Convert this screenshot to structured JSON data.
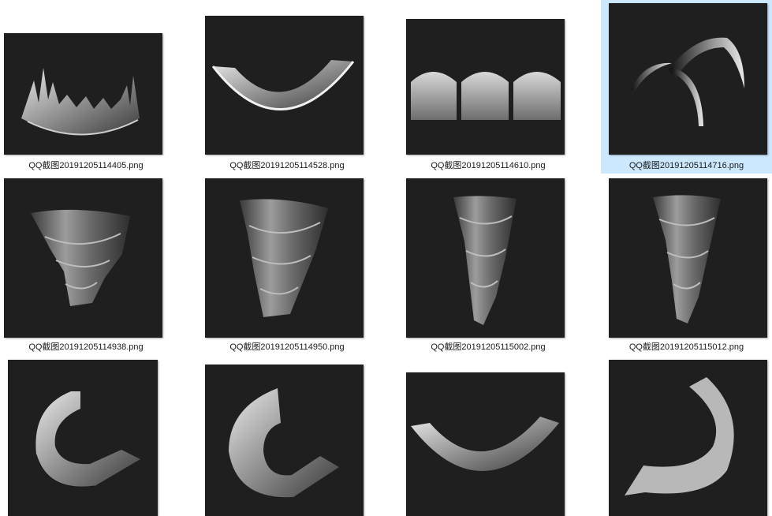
{
  "files": [
    {
      "name": "QQ截图20191205114405.png",
      "selected": false,
      "icon": "jagged-crown-icon"
    },
    {
      "name": "QQ截图20191205114528.png",
      "selected": false,
      "icon": "half-ring-icon"
    },
    {
      "name": "QQ截图20191205114610.png",
      "selected": false,
      "icon": "triple-dome-icon"
    },
    {
      "name": "QQ截图20191205114716.png",
      "selected": true,
      "icon": "crossed-arcs-icon"
    },
    {
      "name": "QQ截图20191205114938.png",
      "selected": false,
      "icon": "twisted-cone-icon"
    },
    {
      "name": "QQ截图20191205114950.png",
      "selected": false,
      "icon": "twisted-cone-icon"
    },
    {
      "name": "QQ截图20191205115002.png",
      "selected": false,
      "icon": "twisted-cone-icon"
    },
    {
      "name": "QQ截图20191205115012.png",
      "selected": false,
      "icon": "twisted-cone-icon"
    },
    {
      "name": "",
      "selected": false,
      "icon": "c-ring-icon"
    },
    {
      "name": "",
      "selected": false,
      "icon": "thick-c-ring-icon"
    },
    {
      "name": "",
      "selected": false,
      "icon": "half-ring-icon"
    },
    {
      "name": "",
      "selected": false,
      "icon": "flat-arc-icon"
    }
  ]
}
